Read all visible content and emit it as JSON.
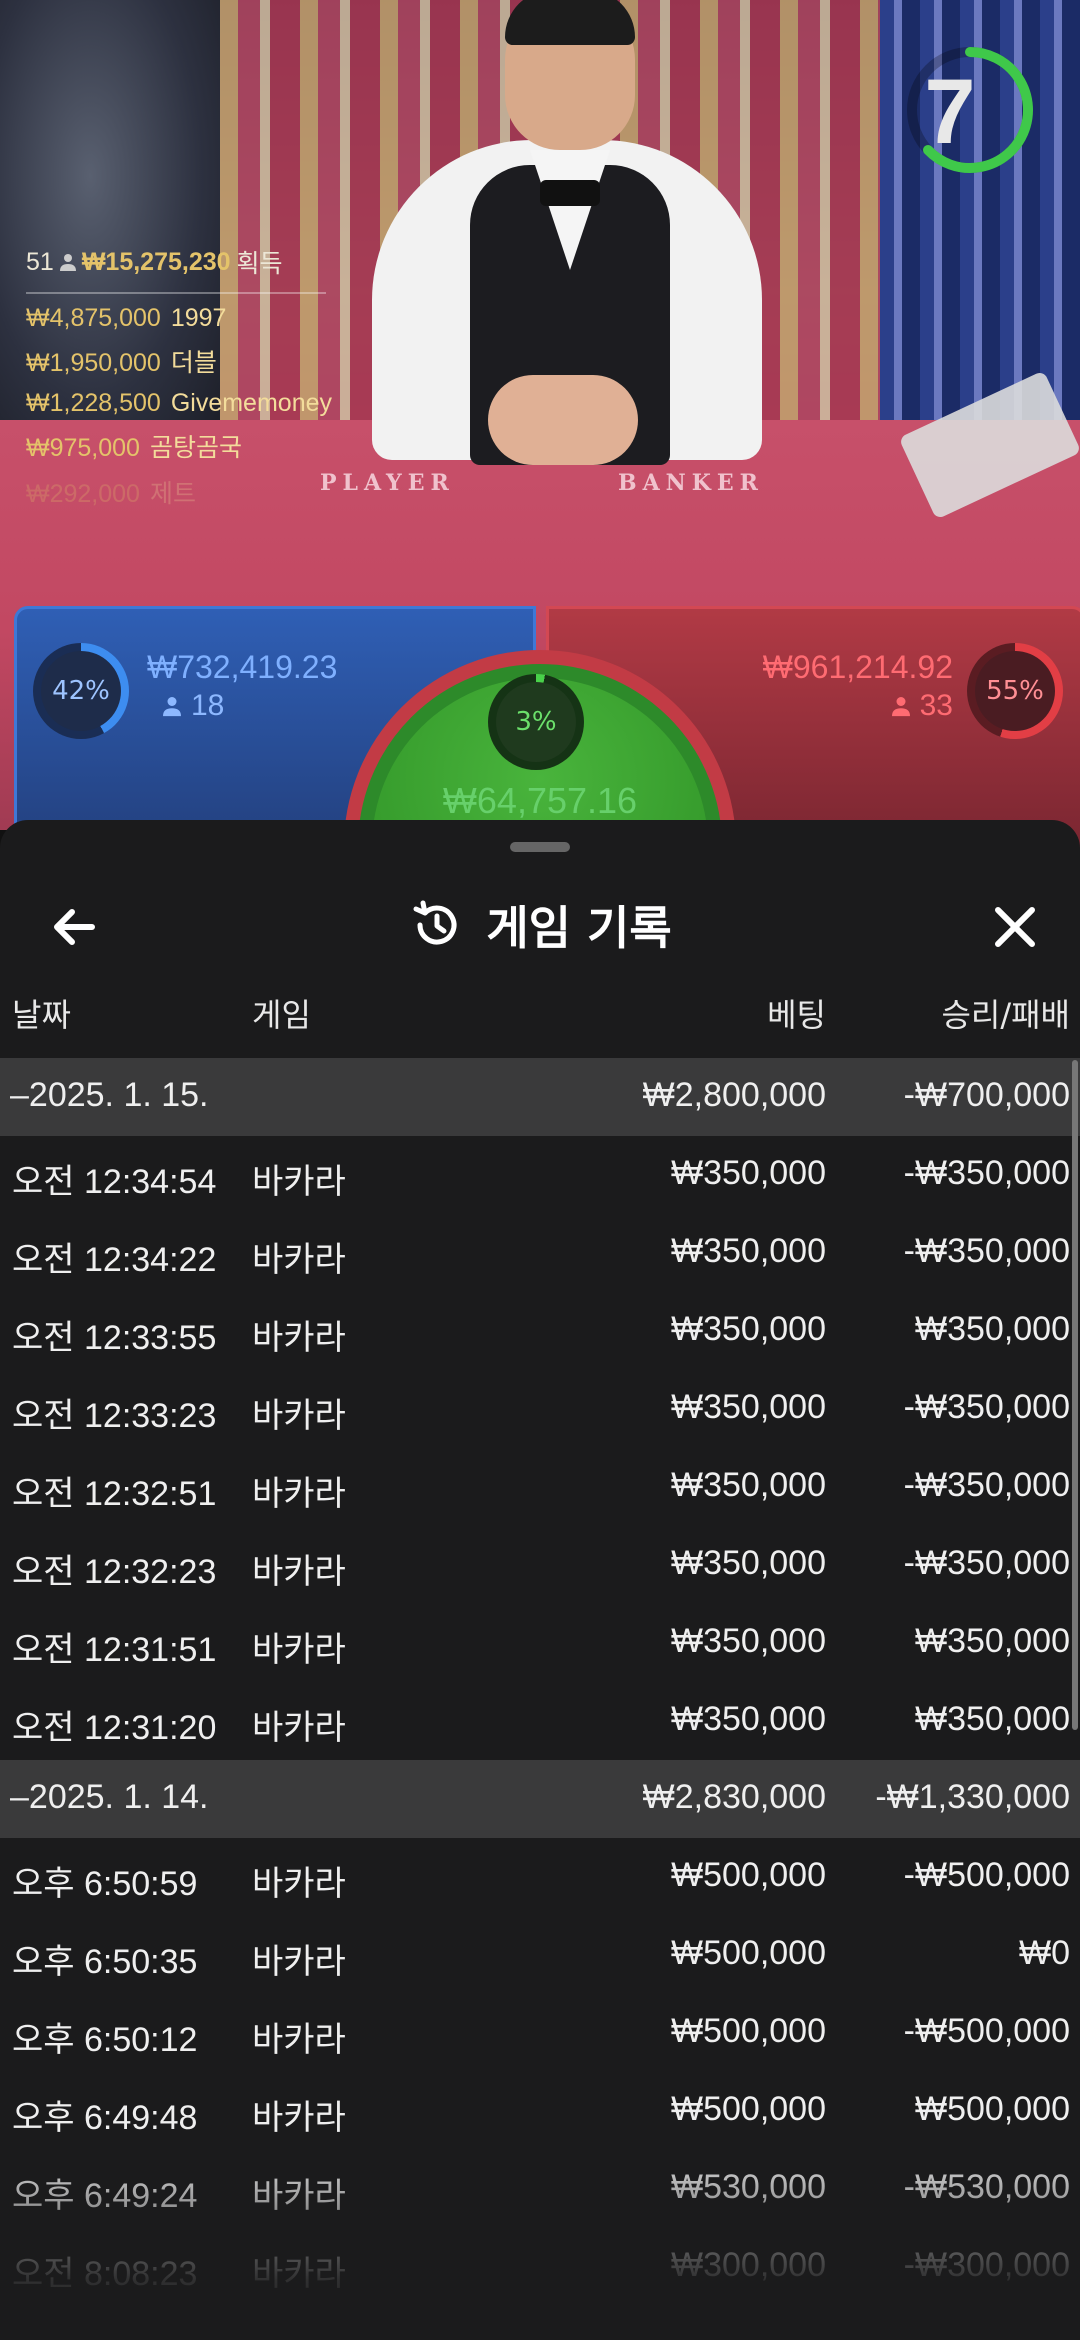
{
  "timer": {
    "seconds": "7"
  },
  "winners": {
    "count": "51",
    "total": "₩15,275,230",
    "total_label": "획득",
    "list": [
      {
        "amount": "₩4,875,000",
        "name": "1997"
      },
      {
        "amount": "₩1,950,000",
        "name": "더블"
      },
      {
        "amount": "₩1,228,500",
        "name": "Givememoney"
      },
      {
        "amount": "₩975,000",
        "name": "곰탕곰국"
      },
      {
        "amount": "₩292,000",
        "name": "제트"
      }
    ]
  },
  "table": {
    "player_label": "PLAYER",
    "banker_label": "BANKER"
  },
  "bets": {
    "player": {
      "percent": "42%",
      "amount": "₩732,419.23",
      "players": "18",
      "color": "#3d8df0"
    },
    "banker": {
      "percent": "55%",
      "amount": "₩961,214.92",
      "players": "33",
      "color": "#e23e45"
    },
    "tie": {
      "percent": "3%",
      "amount": "₩64,757.16",
      "color": "#49d14a"
    }
  },
  "sheet": {
    "title": "게임 기록",
    "icons": {
      "back": "back-arrow-icon",
      "history": "history-icon",
      "close": "close-icon"
    },
    "columns": {
      "date": "날짜",
      "game": "게임",
      "bet": "베팅",
      "result": "승리/패배"
    },
    "rows": [
      {
        "type": "group",
        "date": "–2025. 1. 15.",
        "game": "",
        "bet": "₩2,800,000",
        "result": "-₩700,000"
      },
      {
        "type": "item",
        "date": "오전 12:34:54",
        "game": "바카라",
        "bet": "₩350,000",
        "result": "-₩350,000"
      },
      {
        "type": "item",
        "date": "오전 12:34:22",
        "game": "바카라",
        "bet": "₩350,000",
        "result": "-₩350,000"
      },
      {
        "type": "item",
        "date": "오전 12:33:55",
        "game": "바카라",
        "bet": "₩350,000",
        "result": "₩350,000"
      },
      {
        "type": "item",
        "date": "오전 12:33:23",
        "game": "바카라",
        "bet": "₩350,000",
        "result": "-₩350,000"
      },
      {
        "type": "item",
        "date": "오전 12:32:51",
        "game": "바카라",
        "bet": "₩350,000",
        "result": "-₩350,000"
      },
      {
        "type": "item",
        "date": "오전 12:32:23",
        "game": "바카라",
        "bet": "₩350,000",
        "result": "-₩350,000"
      },
      {
        "type": "item",
        "date": "오전 12:31:51",
        "game": "바카라",
        "bet": "₩350,000",
        "result": "₩350,000"
      },
      {
        "type": "item",
        "date": "오전 12:31:20",
        "game": "바카라",
        "bet": "₩350,000",
        "result": "₩350,000"
      },
      {
        "type": "group",
        "date": "–2025. 1. 14.",
        "game": "",
        "bet": "₩2,830,000",
        "result": "-₩1,330,000"
      },
      {
        "type": "item",
        "date": "오후 6:50:59",
        "game": "바카라",
        "bet": "₩500,000",
        "result": "-₩500,000"
      },
      {
        "type": "item",
        "date": "오후 6:50:35",
        "game": "바카라",
        "bet": "₩500,000",
        "result": "₩0"
      },
      {
        "type": "item",
        "date": "오후 6:50:12",
        "game": "바카라",
        "bet": "₩500,000",
        "result": "-₩500,000"
      },
      {
        "type": "item",
        "date": "오후 6:49:48",
        "game": "바카라",
        "bet": "₩500,000",
        "result": "₩500,000"
      },
      {
        "type": "item",
        "date": "오후 6:49:24",
        "game": "바카라",
        "bet": "₩530,000",
        "result": "-₩530,000"
      },
      {
        "type": "item",
        "date": "오전 8:08:23",
        "game": "바카라",
        "bet": "₩300,000",
        "result": "-₩300,000"
      }
    ]
  }
}
